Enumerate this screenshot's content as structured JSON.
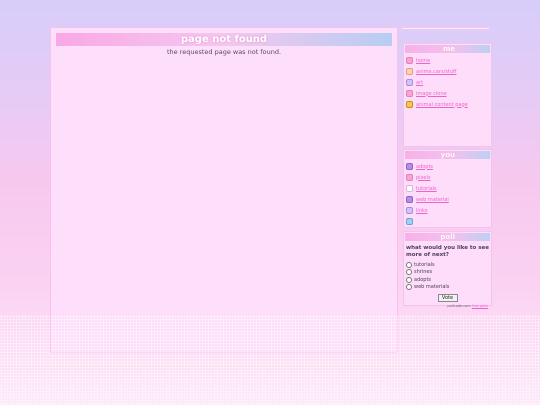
{
  "main": {
    "title": "page not found",
    "message": "the requested page was not found."
  },
  "sidebar": {
    "me": {
      "title": "me",
      "items": [
        {
          "label": "home",
          "icon": "pink-face-icon"
        },
        {
          "label": "anime.cars/stuff",
          "icon": "peach-icon"
        },
        {
          "label": "art",
          "icon": "lavender-icon"
        },
        {
          "label": "image clone",
          "icon": "pink-icon"
        },
        {
          "label": "animal content page",
          "icon": "yellow-animal-icon"
        }
      ]
    },
    "you": {
      "title": "you",
      "items": [
        {
          "label": "adopts",
          "icon": "purple-pixel-icon"
        },
        {
          "label": "pixels",
          "icon": "pink-pixel-icon"
        },
        {
          "label": "tutorials",
          "icon": "white-circle-icon"
        },
        {
          "label": "web material",
          "icon": "purple-heart-icon"
        },
        {
          "label": "links",
          "icon": "lavender-sparkle-icon"
        },
        {
          "label": "",
          "icon": "blue-circle-icon"
        }
      ]
    },
    "poll": {
      "title": "poll",
      "question": "what would you like to see more of next?",
      "options": [
        "tutorials",
        "shrines",
        "adopts",
        "web materials"
      ],
      "vote_label": "Vote",
      "footer_text": "pollcode.com",
      "footer_link": "free polls"
    }
  }
}
